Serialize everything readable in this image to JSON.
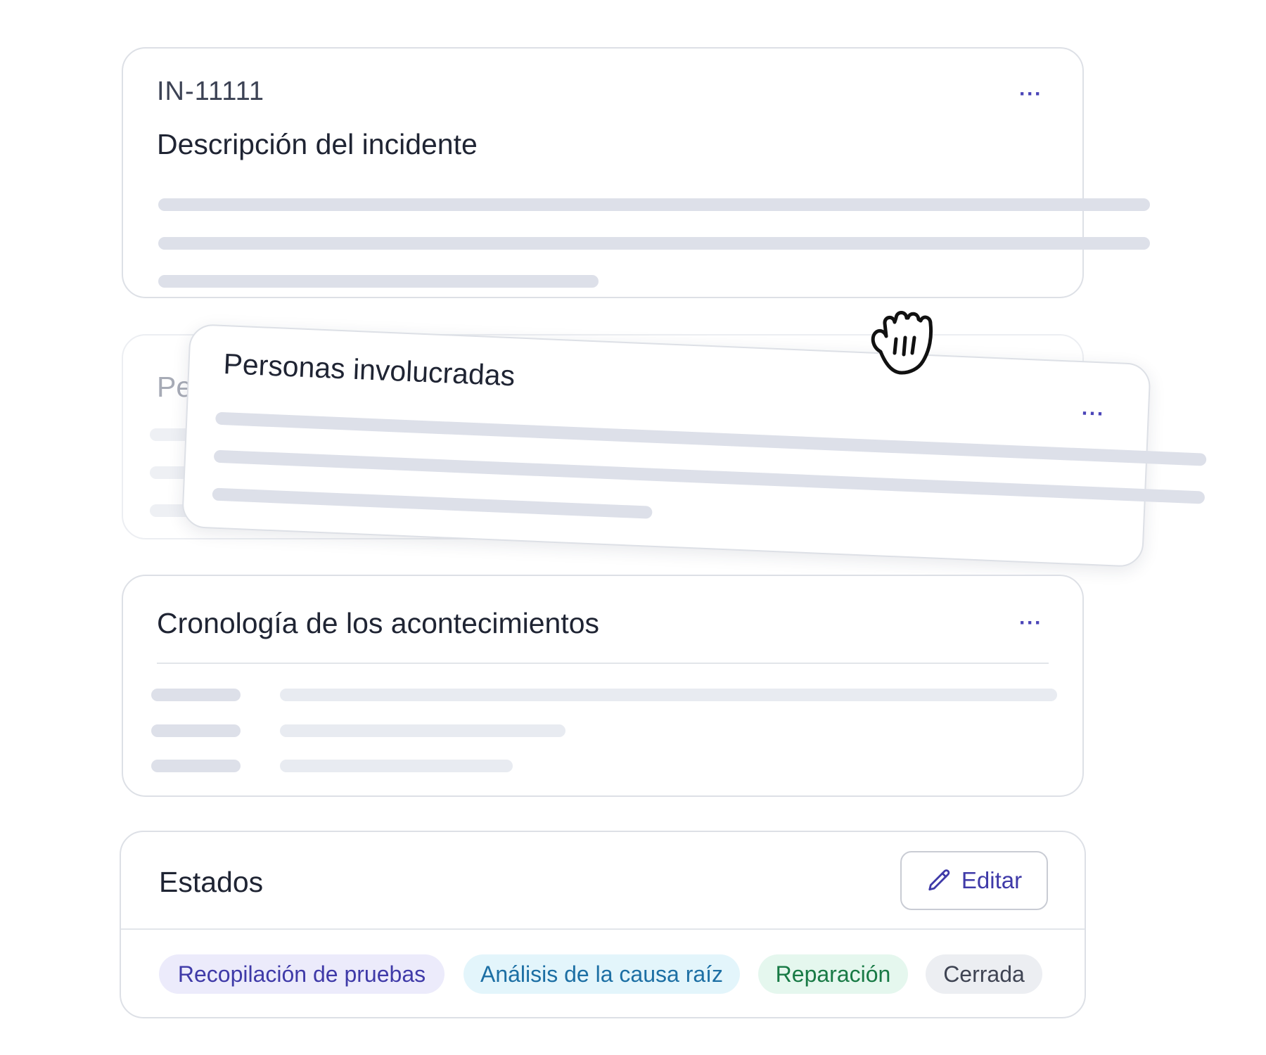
{
  "incident_card": {
    "id": "IN-11111",
    "title": "Descripción del incidente",
    "menu_icon": "more-horizontal-icon",
    "menu_label": "···"
  },
  "people_card": {
    "title": "Personas involucradas",
    "ghost_title": "Pe",
    "menu_icon": "more-horizontal-icon",
    "menu_label": "···"
  },
  "timeline_card": {
    "title": "Cronología de los acontecimientos",
    "menu_icon": "more-horizontal-icon",
    "menu_label": "···"
  },
  "states_card": {
    "title": "Estados",
    "edit_button": {
      "label": "Editar",
      "icon": "pencil-icon"
    },
    "states": [
      {
        "label": "Recopilación de pruebas",
        "color": "#3f3aa8"
      },
      {
        "label": "Análisis de la causa raíz",
        "color": "#1c6fa4"
      },
      {
        "label": "Reparación",
        "color": "#187a45"
      },
      {
        "label": "Cerrada",
        "color": "#3f4453"
      }
    ]
  },
  "cursor": {
    "icon": "grab-hand-icon"
  },
  "colors": {
    "accent": "#4a44b8",
    "border": "#dde0e6",
    "skeleton": "#dde0e9"
  }
}
